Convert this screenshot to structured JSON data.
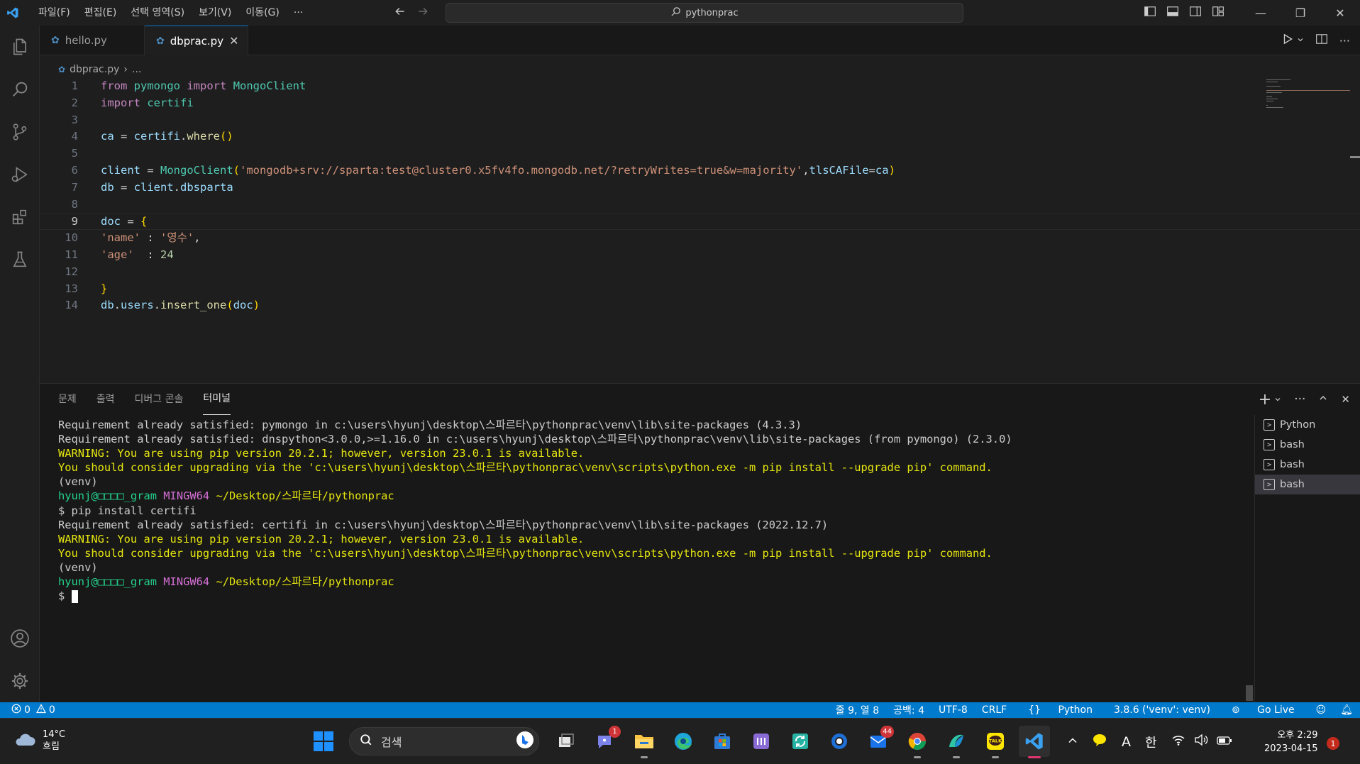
{
  "titlebar": {
    "menu": [
      "파일(F)",
      "편집(E)",
      "선택 영역(S)",
      "보기(V)",
      "이동(G)",
      "···"
    ],
    "search_text": "pythonprac"
  },
  "tabs": [
    {
      "label": "hello.py"
    },
    {
      "label": "dbprac.py"
    }
  ],
  "breadcrumb": {
    "file": "dbprac.py",
    "more": "..."
  },
  "editor": {
    "line_numbers": [
      "1",
      "2",
      "3",
      "4",
      "5",
      "6",
      "7",
      "8",
      "9",
      "10",
      "11",
      "12",
      "13",
      "14"
    ],
    "current_line": 9,
    "tokens": {
      "l1_from": "from",
      "l1_mod": "pymongo",
      "l1_import": "import",
      "l1_cls": "MongoClient",
      "l2_import": "import",
      "l2_mod": "certifi",
      "l4_var": "ca",
      "l4_eq": " = ",
      "l4_mod": "certifi",
      "l4_dot": ".",
      "l4_fn": "where",
      "l4_paren": "()",
      "l6_var": "client",
      "l6_eq": " = ",
      "l6_cls": "MongoClient",
      "l6_open": "(",
      "l6_str": "'mongodb+srv://sparta:test@cluster0.x5fv4fo.mongodb.net/?retryWrites=true&w=majority'",
      "l6_comma": ",",
      "l6_kw": "tlsCAFile",
      "l6_eq2": "=",
      "l6_arg": "ca",
      "l6_close": ")",
      "l7_var": "db",
      "l7_eq": " = ",
      "l7_mod": "client",
      "l7_dot": ".",
      "l7_attr": "dbsparta",
      "l9_var": "doc",
      "l9_eq": " = ",
      "l9_brace": "{",
      "l10_key": "'name'",
      "l10_colon": " : ",
      "l10_val": "'영수'",
      "l10_comma": ",",
      "l11_key": "'age'",
      "l11_colon": "  : ",
      "l11_val": "24",
      "l13_brace": "}",
      "l14_db": "db",
      "l14_dot1": ".",
      "l14_users": "users",
      "l14_dot2": ".",
      "l14_fn": "insert_one",
      "l14_open": "(",
      "l14_arg": "doc",
      "l14_close": ")"
    }
  },
  "panel": {
    "tabs": [
      "문제",
      "출력",
      "디버그 콘솔",
      "터미널"
    ],
    "active_tab": "터미널",
    "terminal_lines": [
      "Requirement already satisfied: pymongo in c:\\users\\hyunj\\desktop\\스파르타\\pythonprac\\venv\\lib\\site-packages (4.3.3)",
      "Requirement already satisfied: dnspython<3.0.0,>=1.16.0 in c:\\users\\hyunj\\desktop\\스파르타\\pythonprac\\venv\\lib\\site-packages (from pymongo) (2.3.0)",
      "WARNING: You are using pip version 20.2.1; however, version 23.0.1 is available.",
      "You should consider upgrading via the 'c:\\users\\hyunj\\desktop\\스파르타\\pythonprac\\venv\\scripts\\python.exe -m pip install --upgrade pip' command.",
      "(venv)",
      "$ pip install certifi",
      "Requirement already satisfied: certifi in c:\\users\\hyunj\\desktop\\스파르타\\pythonprac\\venv\\lib\\site-packages (2022.12.7)",
      "WARNING: You are using pip version 20.2.1; however, version 23.0.1 is available.",
      "You should consider upgrading via the 'c:\\users\\hyunj\\desktop\\스파르타\\pythonprac\\venv\\scripts\\python.exe -m pip install --upgrade pip' command.",
      "(venv)",
      "$ "
    ],
    "prompt": {
      "user": "hyunj@□□□□_gram",
      "host": "MINGW64",
      "path": "~/Desktop/스파르타/pythonprac"
    },
    "terminals": [
      "Python",
      "bash",
      "bash",
      "bash"
    ]
  },
  "statusbar": {
    "errors": "0",
    "warnings": "0",
    "cursor_pos": "줄 9, 열 8",
    "spaces": "공백: 4",
    "encoding": "UTF-8",
    "eol": "CRLF",
    "language": "Python",
    "interpreter": "3.8.6 ('venv': venv)",
    "golive": "Go Live"
  },
  "taskbar": {
    "weather_temp": "14°C",
    "weather_desc": "흐림",
    "search_placeholder": "검색",
    "teams_badge": "1",
    "mail_badge": "44",
    "ime_a": "A",
    "ime_han": "한",
    "time": "오후 2:29",
    "date": "2023-04-15",
    "notification_count": "1"
  },
  "colors": {
    "accent": "#007acc",
    "editor_bg": "#1e1e1e",
    "panel_bg": "#181818",
    "terminal_yellow": "#e5e510",
    "terminal_green": "#23d18b",
    "terminal_magenta": "#d670d6"
  }
}
